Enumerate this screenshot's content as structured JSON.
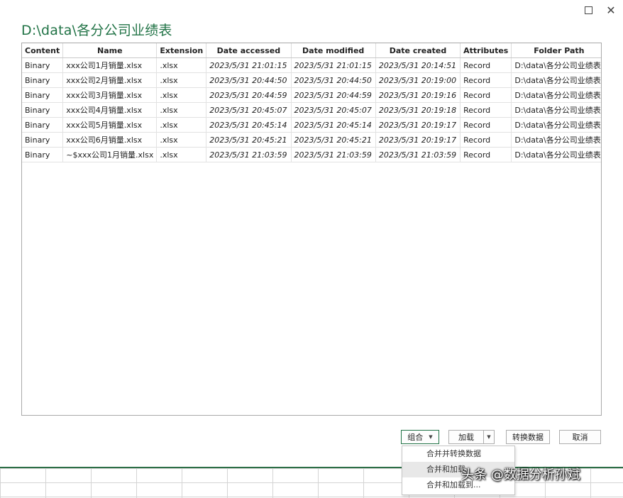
{
  "window": {
    "title": "D:\\data\\各分公司业绩表"
  },
  "table": {
    "columns": [
      "Content",
      "Name",
      "Extension",
      "Date accessed",
      "Date modified",
      "Date created",
      "Attributes",
      "Folder Path"
    ],
    "rows": [
      [
        "Binary",
        "xxx公司1月销量.xlsx",
        ".xlsx",
        "2023/5/31 21:01:15",
        "2023/5/31 21:01:15",
        "2023/5/31 20:14:51",
        "Record",
        "D:\\data\\各分公司业绩表\\"
      ],
      [
        "Binary",
        "xxx公司2月销量.xlsx",
        ".xlsx",
        "2023/5/31 20:44:50",
        "2023/5/31 20:44:50",
        "2023/5/31 20:19:00",
        "Record",
        "D:\\data\\各分公司业绩表\\"
      ],
      [
        "Binary",
        "xxx公司3月销量.xlsx",
        ".xlsx",
        "2023/5/31 20:44:59",
        "2023/5/31 20:44:59",
        "2023/5/31 20:19:16",
        "Record",
        "D:\\data\\各分公司业绩表\\"
      ],
      [
        "Binary",
        "xxx公司4月销量.xlsx",
        ".xlsx",
        "2023/5/31 20:45:07",
        "2023/5/31 20:45:07",
        "2023/5/31 20:19:18",
        "Record",
        "D:\\data\\各分公司业绩表\\"
      ],
      [
        "Binary",
        "xxx公司5月销量.xlsx",
        ".xlsx",
        "2023/5/31 20:45:14",
        "2023/5/31 20:45:14",
        "2023/5/31 20:19:17",
        "Record",
        "D:\\data\\各分公司业绩表\\"
      ],
      [
        "Binary",
        "xxx公司6月销量.xlsx",
        ".xlsx",
        "2023/5/31 20:45:21",
        "2023/5/31 20:45:21",
        "2023/5/31 20:19:17",
        "Record",
        "D:\\data\\各分公司业绩表\\"
      ],
      [
        "Binary",
        "~$xxx公司1月销量.xlsx",
        ".xlsx",
        "2023/5/31 21:03:59",
        "2023/5/31 21:03:59",
        "2023/5/31 21:03:59",
        "Record",
        "D:\\data\\各分公司业绩表\\"
      ]
    ]
  },
  "buttons": {
    "combine": "组合",
    "load": "加载",
    "transform": "转换数据",
    "cancel": "取消"
  },
  "dropdown": {
    "items": [
      "合并并转换数据",
      "合并和加载",
      "合并和加载到..."
    ]
  },
  "watermark": "头条 @数据分析孙斌",
  "icons": {
    "maximize": "maximize-icon",
    "close": "close-icon",
    "caret": "caret-down-icon"
  },
  "colors": {
    "accent": "#217346"
  }
}
